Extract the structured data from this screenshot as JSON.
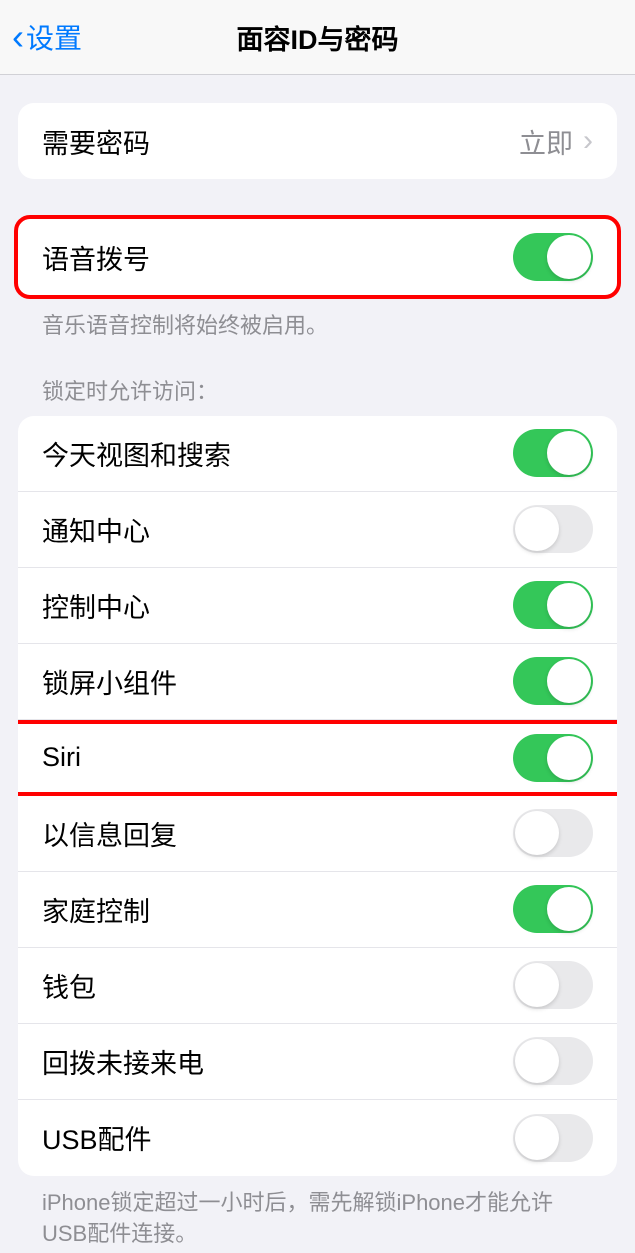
{
  "header": {
    "back_label": "设置",
    "title": "面容ID与密码"
  },
  "passcode_section": {
    "require_label": "需要密码",
    "require_value": "立即"
  },
  "voice_section": {
    "voice_dial_label": "语音拨号",
    "voice_dial_on": true,
    "footer": "音乐语音控制将始终被启用。"
  },
  "lock_section": {
    "header": "锁定时允许访问：",
    "items": [
      {
        "label": "今天视图和搜索",
        "on": true
      },
      {
        "label": "通知中心",
        "on": false
      },
      {
        "label": "控制中心",
        "on": true
      },
      {
        "label": "锁屏小组件",
        "on": true
      },
      {
        "label": "Siri",
        "on": true
      },
      {
        "label": "以信息回复",
        "on": false
      },
      {
        "label": "家庭控制",
        "on": true
      },
      {
        "label": "钱包",
        "on": false
      },
      {
        "label": "回拨未接来电",
        "on": false
      },
      {
        "label": "USB配件",
        "on": false
      }
    ],
    "footer": "iPhone锁定超过一小时后，需先解锁iPhone才能允许USB配件连接。"
  },
  "highlights": {
    "voice_dial": true,
    "siri_index": 4
  }
}
